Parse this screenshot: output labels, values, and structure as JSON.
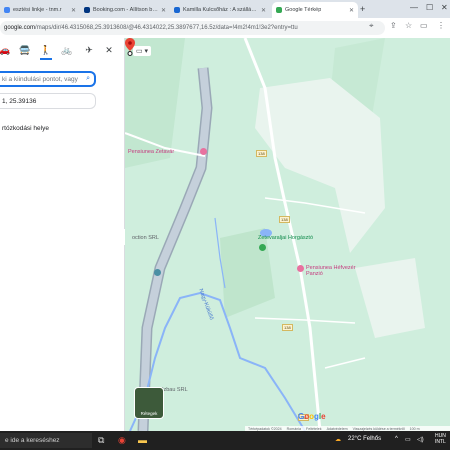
{
  "browser": {
    "tabs": [
      {
        "label": "esztési linkje - tnm.r",
        "color": "#4285f4",
        "active": false
      },
      {
        "label": "Booking.com - Állítson be új b",
        "color": "#003580",
        "active": false
      },
      {
        "label": "Kamilla Kulcsőház : A szállás n",
        "color": "#1967d2",
        "active": false
      },
      {
        "label": "Google Térkép",
        "color": "#34a853",
        "active": true
      }
    ],
    "url_host": "google.com",
    "url_path": "/maps/dir/46.4315068,25.3913608/@46.4314022,25.3897677,16.5z/data=!4m2!4m1!3e2?entry=ttu"
  },
  "directions": {
    "modes": [
      "drive-icon",
      "transit-icon",
      "walk-icon",
      "bike-icon",
      "flight-icon"
    ],
    "active_mode": "walk-icon",
    "close_label": "✕",
    "origin_placeholder": "ki a kiindulási pontot, vagy",
    "destination_value": "1, 25.39136",
    "suggestion": "rtózkodási helye"
  },
  "map": {
    "labels": {
      "penziunea_zetavar": "Pensiunea Zetavár",
      "zetelakai": "Zetelakai víz",
      "horgaszto": "Zetevaraljai Horgásztó",
      "mefvezer": "Pensiunea Héfvezér Panzió",
      "nagy_kukullo": "Nagy-Küküllő",
      "construction": "oction SRL",
      "holzbau": "men Holzbau SRL"
    },
    "road_shields": [
      "138",
      "138",
      "138",
      "138"
    ],
    "layers_label": "Rétegek",
    "footer": [
      "Térképadatok ©2024",
      "Románia",
      "Feltételek",
      "Adatvédelem",
      "Visszajelzés küldése a termékről",
      "100 m"
    ],
    "google_logo": "Google"
  },
  "taskbar": {
    "search_text": "e ide a kereséshez",
    "weather": "22°C Felhős",
    "lang": "HUN",
    "lang2": "INTL"
  }
}
